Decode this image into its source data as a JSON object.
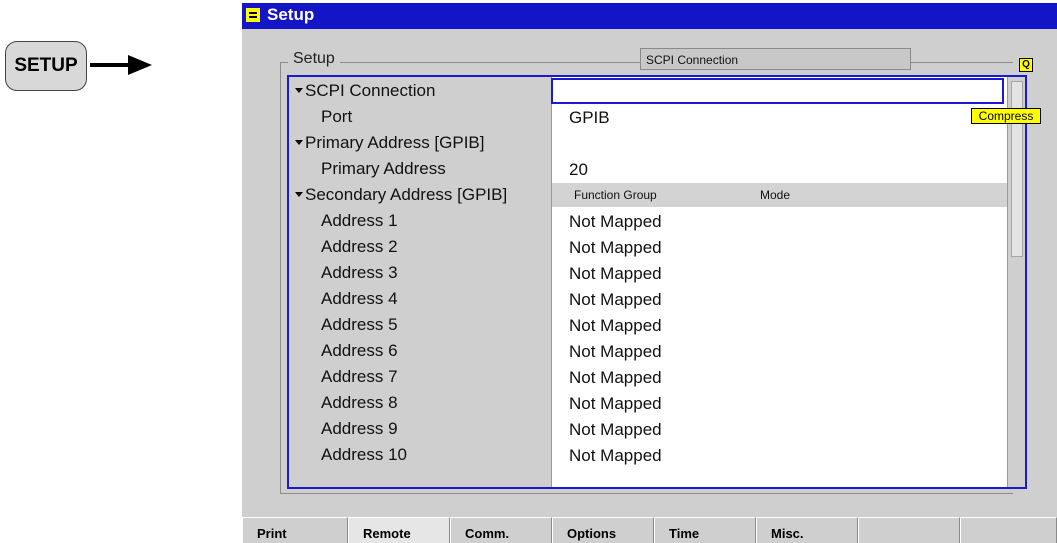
{
  "hardkey": {
    "label": "SETUP"
  },
  "window": {
    "title": "Setup"
  },
  "group": {
    "label": "Setup",
    "selection_field": "SCPI Connection",
    "compress_label": "Compress",
    "q_icon_glyph": "Q"
  },
  "subheader": {
    "function_group": "Function Group",
    "mode": "Mode"
  },
  "rows": [
    {
      "label": "SCPI Connection",
      "value": ""
    },
    {
      "label": "Port",
      "value": "GPIB"
    },
    {
      "label": "Primary Address [GPIB]",
      "value": ""
    },
    {
      "label": "Primary Address",
      "value": "20"
    },
    {
      "label": "Secondary Address [GPIB]",
      "value": ""
    },
    {
      "label": "Address 1",
      "value": "Not Mapped"
    },
    {
      "label": "Address 2",
      "value": "Not Mapped"
    },
    {
      "label": "Address 3",
      "value": "Not Mapped"
    },
    {
      "label": "Address 4",
      "value": "Not Mapped"
    },
    {
      "label": "Address 5",
      "value": "Not Mapped"
    },
    {
      "label": "Address 6",
      "value": "Not Mapped"
    },
    {
      "label": "Address 7",
      "value": "Not Mapped"
    },
    {
      "label": "Address 8",
      "value": "Not Mapped"
    },
    {
      "label": "Address 9",
      "value": "Not Mapped"
    },
    {
      "label": "Address 10",
      "value": "Not Mapped"
    }
  ],
  "tabs": [
    {
      "label": "Print"
    },
    {
      "label": "Remote"
    },
    {
      "label": "Comm."
    },
    {
      "label": "Options"
    },
    {
      "label": "Time"
    },
    {
      "label": "Misc."
    },
    {
      "label": ""
    },
    {
      "label": ""
    }
  ],
  "colors": {
    "title_bar": "#1515c8",
    "highlight": "#ffff00",
    "focus_border": "#1a1ad0",
    "panel": "#cfcfcf"
  }
}
